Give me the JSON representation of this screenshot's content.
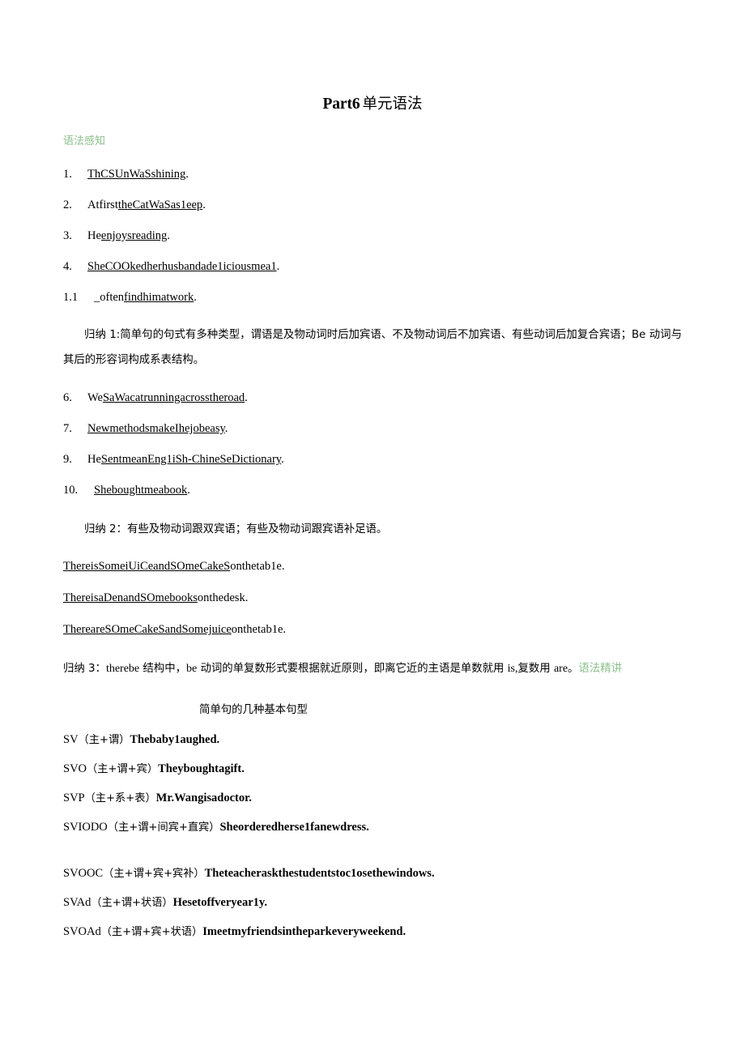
{
  "document": {
    "title_en": "Part6",
    "title_cn": "单元语法"
  },
  "sections": {
    "perception_heading": "语法感知",
    "intensive_heading_inline": "语法",
    "intensive_heading_wrap": "精讲"
  },
  "sentences_group_1": [
    {
      "num": "1.",
      "parts": [
        {
          "text": "ThCSUnWaSshining",
          "underline": true
        },
        {
          "text": ".",
          "underline": false
        }
      ]
    },
    {
      "num": "2.",
      "parts": [
        {
          "text": "Atfirst",
          "underline": false
        },
        {
          "text": "theCatWaSas1eep",
          "underline": true
        },
        {
          "text": ".",
          "underline": false
        }
      ]
    },
    {
      "num": "3.",
      "parts": [
        {
          "text": "He",
          "underline": false
        },
        {
          "text": "enjoysreading",
          "underline": true
        },
        {
          "text": ".",
          "underline": false
        }
      ]
    },
    {
      "num": "4.",
      "parts": [
        {
          "text": "SheCOOkedherhusband",
          "underline": true
        },
        {
          "text": "ade1iciousmea1",
          "underline": true
        },
        {
          "text": ".",
          "underline": false
        }
      ]
    },
    {
      "num": "1.1",
      "parts": [
        {
          "text": "_",
          "underline": false
        },
        {
          "text": "often",
          "underline": false
        },
        {
          "text": "findhimatwork",
          "underline": true
        },
        {
          "text": ".",
          "underline": false
        }
      ]
    }
  ],
  "summary_1": "归纳 1:简单句的句式有多种类型，谓语是及物动词时后加宾语、不及物动词后不加宾语、有些动词后加复合宾语；Be 动词与其后的形容词构成系表结构。",
  "sentences_group_2": [
    {
      "num": "6.",
      "parts": [
        {
          "text": "We",
          "underline": false
        },
        {
          "text": "SaWacatrunningacrosstheroad",
          "underline": true
        },
        {
          "text": ".",
          "underline": false
        }
      ]
    },
    {
      "num": "7.",
      "parts": [
        {
          "text": "NewmethodsmakeIhejobeasy",
          "underline": true
        },
        {
          "text": ".",
          "underline": false
        }
      ]
    },
    {
      "num": "9.",
      "parts": [
        {
          "text": "He",
          "underline": false
        },
        {
          "text": "Sent",
          "underline": true
        },
        {
          "text": "mean",
          "underline": true
        },
        {
          "text": "Eng1iSh-ChineSeDictionary",
          "underline": true
        },
        {
          "text": ".",
          "underline": false
        }
      ]
    },
    {
      "num": "10.",
      "parts": [
        {
          "text": "Shebought",
          "underline": true
        },
        {
          "text": "mea",
          "underline": true
        },
        {
          "text": "book",
          "underline": true
        },
        {
          "text": ".",
          "underline": false
        }
      ]
    }
  ],
  "summary_2": "归纳 2：有些及物动词跟双宾语；有些及物动词跟宾语补足语。",
  "there_lines": [
    {
      "parts": [
        {
          "text": "Thereis",
          "underline": true
        },
        {
          "text": "SomeiUiCeandSOmeCakeS",
          "underline": true
        },
        {
          "text": "onthetab1e.",
          "underline": false
        }
      ]
    },
    {
      "parts": [
        {
          "text": "ThereisaDenandSOmebooks",
          "underline": true
        },
        {
          "text": "onthedesk.",
          "underline": false
        }
      ]
    },
    {
      "parts": [
        {
          "text": "ThereareSOmeCakeSandSomejuice",
          "underline": true
        },
        {
          "text": "onthetab1e.",
          "underline": false
        }
      ]
    }
  ],
  "summary_3": {
    "lead": "归纳 3：",
    "latin_1": "therebe",
    "mid_1": " 结构中，",
    "latin_2": "be",
    "mid_2": " 动词的单复数形式要根据就近原则，即离它近的主语是单数就用 ",
    "latin_3": "is,",
    "mid_3": "复数用 ",
    "latin_4": "are",
    "tail": "。"
  },
  "patterns": {
    "heading": "简单句的几种基本句型",
    "rows": [
      {
        "code": "SV",
        "paren": "（主+谓）",
        "example": "Thebaby1aughed.",
        "extra_gap": false
      },
      {
        "code": "SVO",
        "paren": "（主+谓+宾）",
        "example": "Theyboughtagift.",
        "extra_gap": false
      },
      {
        "code": "SVP",
        "paren": "（主+系+表）",
        "example": "Mr.Wangisadoctor.",
        "extra_gap": false
      },
      {
        "code": "SVIODO",
        "paren": "（主+谓+间宾+直宾）",
        "example": "Sheorderedherse1fanewdress.",
        "extra_gap": false
      },
      {
        "code": "SVOOC",
        "paren": "（主+谓+宾+宾补）",
        "example": "Theteacheraskthestudentstoc1osethewindows.",
        "extra_gap": true
      },
      {
        "code": "SVAd",
        "paren": "（主+谓+状语）",
        "example": "Hesetoffveryear1y.",
        "extra_gap": false
      },
      {
        "code": "SVOAd",
        "paren": "（主+谓+宾+状语）",
        "example": "Imeetmyfriendsintheparkeveryweekend.",
        "extra_gap": false
      }
    ]
  },
  "colors": {
    "accent_green": "#8cbf8c",
    "text": "#000000",
    "page_bg": "#ffffff"
  }
}
